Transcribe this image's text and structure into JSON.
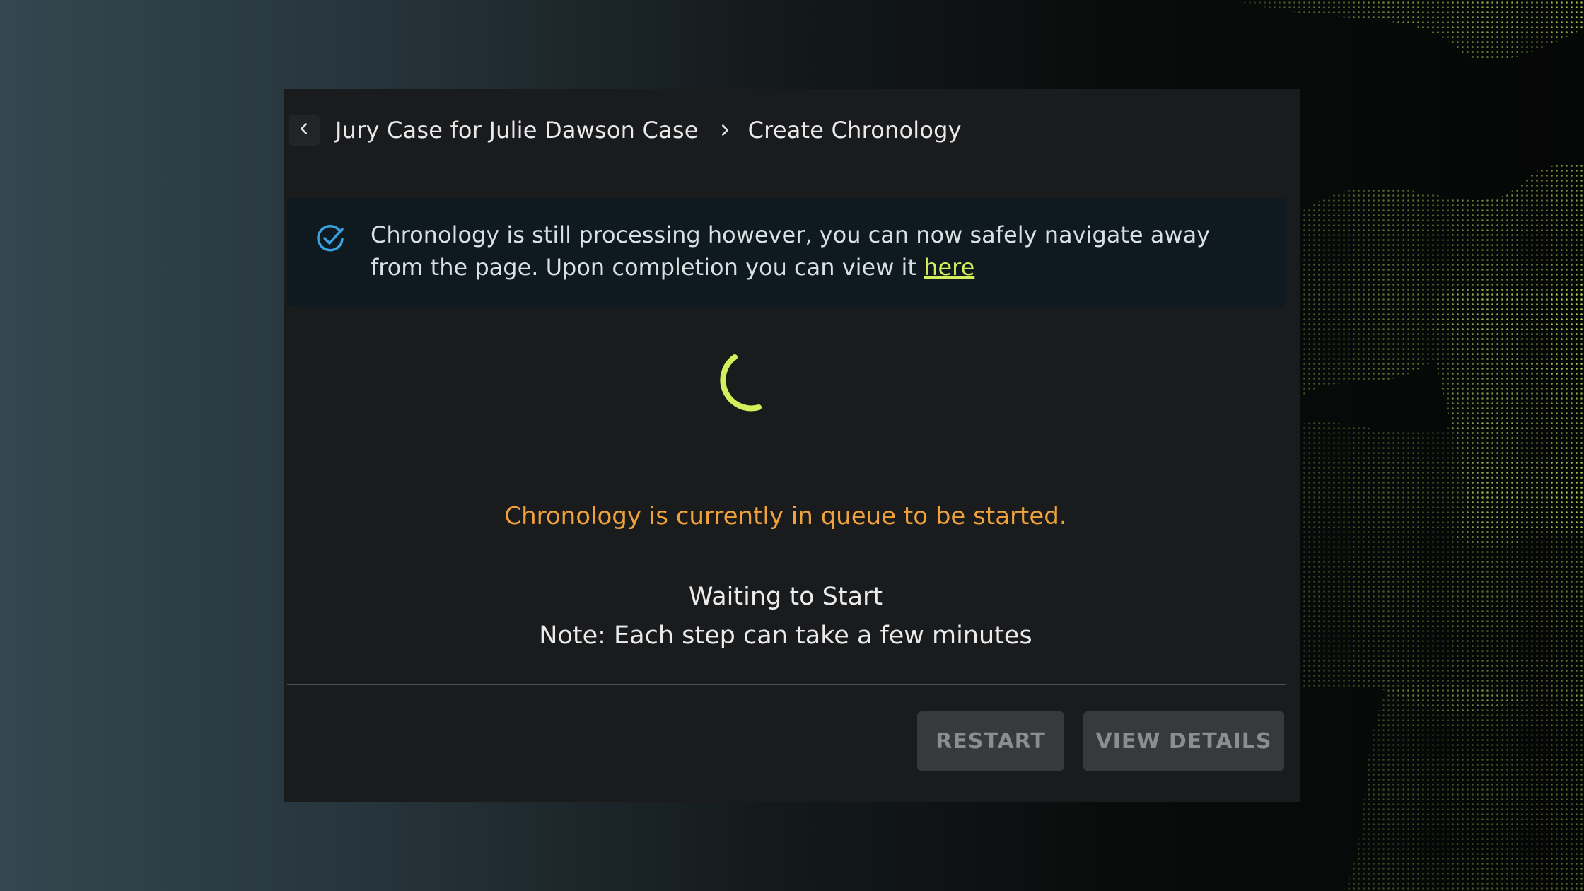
{
  "breadcrumb": {
    "parent": "Jury Case for Julie Dawson Case",
    "current": "Create Chronology"
  },
  "notice": {
    "message": "Chronology is still processing however, you can now safely navigate away from the page. Upon completion you can view it",
    "link_text": "here"
  },
  "status": {
    "queue_message": "Chronology is currently in queue to be started.",
    "main": "Waiting to Start",
    "note": "Note: Each step can take a few minutes"
  },
  "buttons": {
    "restart": "RESTART",
    "view_details": "VIEW DETAILS"
  },
  "icons": {
    "back": "chevron-left-icon",
    "separator": "chevron-right-icon",
    "notice": "check-circle-icon",
    "spinner": "loading-spinner"
  },
  "colors": {
    "accent": "#d4ef5b",
    "warning": "#f0a23b",
    "info_icon": "#3aa0e0",
    "panel_bg": "#1a1b1d",
    "notice_bg": "#0e1a20"
  }
}
